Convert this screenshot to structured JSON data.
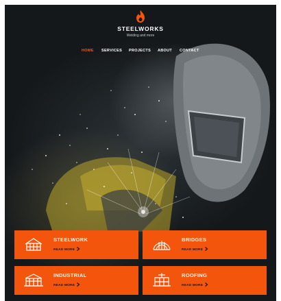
{
  "brand": {
    "name": "STEELWORKS",
    "tagline": "Welding and more",
    "logo_icon": "flame-logo-icon",
    "accent_color": "#f4550c"
  },
  "nav": {
    "items": [
      {
        "label": "HOME",
        "active": true
      },
      {
        "label": "SERVICES",
        "active": false
      },
      {
        "label": "PROJECTS",
        "active": false
      },
      {
        "label": "ABOUT",
        "active": false
      },
      {
        "label": "CONTACT",
        "active": false
      }
    ]
  },
  "hero": {
    "image": "welder-with-helmet-sparks"
  },
  "services": [
    {
      "title": "STEELWORK",
      "link_label": "READ MORE",
      "icon": "warehouse-icon"
    },
    {
      "title": "BRIDGES",
      "link_label": "READ MORE",
      "icon": "arch-bridge-icon"
    },
    {
      "title": "INDUSTRIAL",
      "link_label": "READ MORE",
      "icon": "industrial-building-icon"
    },
    {
      "title": "ROOFING",
      "link_label": "READ MORE",
      "icon": "roof-frame-icon"
    }
  ]
}
